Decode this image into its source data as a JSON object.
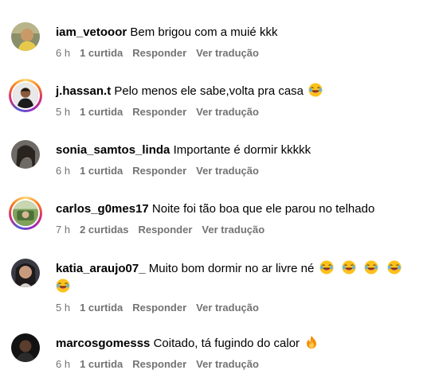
{
  "comments": [
    {
      "username": "iam_vetooor",
      "text": "Bem brigou com a muié kkk",
      "time": "6 h",
      "likes": "1 curtida",
      "reply_label": "Responder",
      "translate_label": "Ver tradução"
    },
    {
      "username": "j.hassan.t",
      "text": "Pelo menos ele sabe,volta pra casa",
      "emojis": [
        "laughing-emoji"
      ],
      "time": "5 h",
      "likes": "1 curtida",
      "reply_label": "Responder",
      "translate_label": "Ver tradução"
    },
    {
      "username": "sonia_samtos_linda",
      "text": "Importante é dormir kkkkk",
      "time": "6 h",
      "likes": "1 curtida",
      "reply_label": "Responder",
      "translate_label": "Ver tradução"
    },
    {
      "username": "carlos_g0mes17",
      "text": "Noite foi tão boa que ele parou no telhado",
      "time": "7 h",
      "likes": "2 curtidas",
      "reply_label": "Responder",
      "translate_label": "Ver tradução"
    },
    {
      "username": "katia_araujo07_",
      "text": "Muito bom dormir no ar livre né",
      "emojis": [
        "laughing-emoji",
        "laughing-emoji",
        "laughing-emoji",
        "laughing-emoji",
        "laughing-emoji"
      ],
      "time": "5 h",
      "likes": "1 curtida",
      "reply_label": "Responder",
      "translate_label": "Ver tradução"
    },
    {
      "username": "marcosgomesss",
      "text": "Coitado, tá fugindo do calor",
      "emojis": [
        "fire-emoji"
      ],
      "time": "6 h",
      "likes": "1 curtida",
      "reply_label": "Responder",
      "translate_label": "Ver tradução"
    }
  ],
  "colors": {
    "meta_text": "#737373",
    "story_ring": "#d62976"
  }
}
